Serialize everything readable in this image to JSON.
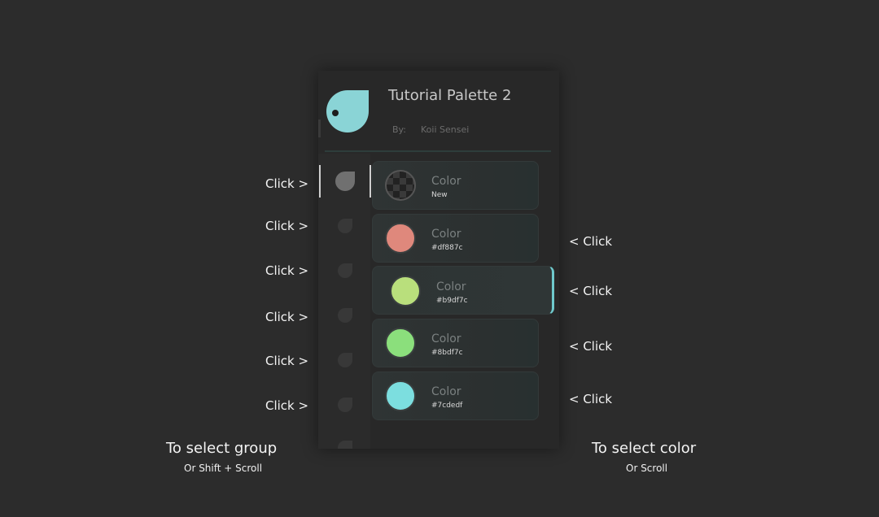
{
  "left_hints": [
    "Click >",
    "Click >",
    "Click >",
    "Click >",
    "Click >",
    "Click >"
  ],
  "right_hints": [
    "< Click",
    "< Click",
    "< Click",
    "< Click"
  ],
  "left_caption": {
    "main": "To select group",
    "sub": "Or Shift + Scroll"
  },
  "right_caption": {
    "main": "To select color",
    "sub": "Or Scroll"
  },
  "palette": {
    "title": "Tutorial Palette 2",
    "by_label": "By:",
    "author": "Koii Sensei",
    "accent_color": "#8ad4d6",
    "logo_icon": "droplet-icon",
    "group_icon": "droplet-icon"
  },
  "colors": [
    {
      "label": "Color",
      "code": "New",
      "hex": null,
      "selected": false
    },
    {
      "label": "Color",
      "code": "#df887c",
      "hex": "#df887c",
      "selected": false
    },
    {
      "label": "Color",
      "code": "#b9df7c",
      "hex": "#b9df7c",
      "selected": true
    },
    {
      "label": "Color",
      "code": "#8bdf7c",
      "hex": "#8bdf7c",
      "selected": false
    },
    {
      "label": "Color",
      "code": "#7cdedf",
      "hex": "#7cdedf",
      "selected": false
    }
  ]
}
